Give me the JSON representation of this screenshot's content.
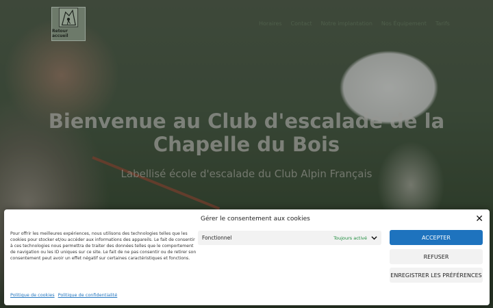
{
  "header": {
    "logo_text": "Retour accueil",
    "nav": [
      "Horaires",
      "Contact",
      "Notre implantation",
      "Nos Équipement",
      "Tarifs"
    ]
  },
  "hero": {
    "title": "Bienvenue au Club d'escalade de la Chapelle du Bois",
    "subtitle": "Labellisé école d'escalade du Club Alpin Français"
  },
  "cookie_banner": {
    "title": "Gérer le consentement aux cookies",
    "text": "Pour offrir les meilleures expériences, nous utilisons des technologies telles que les cookies pour stocker et/ou accéder aux informations des appareils. Le fait de consentir à ces technologies nous permettra de traiter des données telles que le comportement de navigation ou les ID uniques sur ce site. Le fait de ne pas consentir ou de retirer son consentement peut avoir un effet négatif sur certaines caractéristiques et fonctions.",
    "preference": {
      "label": "Fonctionnel",
      "status": "Toujours activé"
    },
    "buttons": {
      "accept": "Accepter",
      "refuse": "Refuser",
      "save": "Enregistrer les préférences"
    },
    "links": {
      "cookie_policy": "Politique de cookies",
      "privacy_policy": "Politique de confidentialité"
    }
  },
  "colors": {
    "accent": "#1e73be",
    "status_green": "#1a8a3a"
  }
}
